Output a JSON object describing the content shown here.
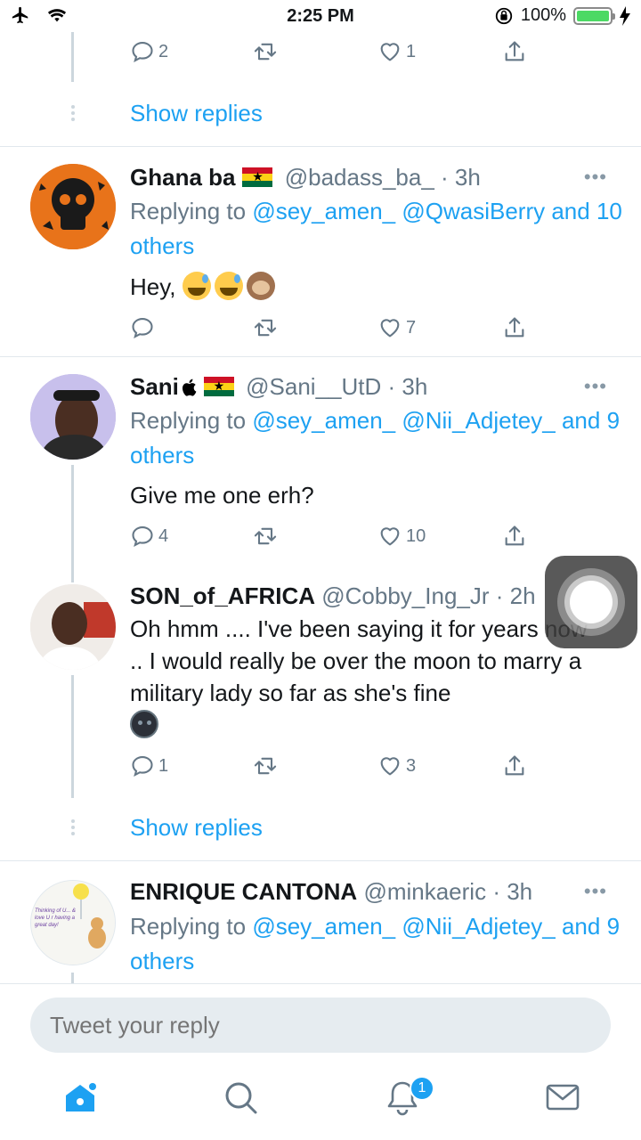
{
  "status_bar": {
    "time": "2:25 PM",
    "battery": "100%"
  },
  "top_actions": {
    "reply_count": "2",
    "retweet_count": "",
    "like_count": "1"
  },
  "show_replies_1": "Show replies",
  "show_replies_2": "Show replies",
  "tweets": [
    {
      "name": "Ghana ba",
      "handle": "@badass_ba_",
      "time": "3h",
      "replying_prefix": "Replying to",
      "replying_users": "@sey_amen_ @QwasiBerry",
      "replying_and": "and",
      "replying_others": "10 others",
      "text": "Hey,",
      "reply_count": "",
      "like_count": "7"
    },
    {
      "name": "Sani",
      "handle": "@Sani__UtD",
      "time": "3h",
      "replying_prefix": "Replying to",
      "replying_users": "@sey_amen_ @Nii_Adjetey_",
      "replying_and": "and",
      "replying_others": "9 others",
      "text": "Give me one erh?",
      "reply_count": "4",
      "like_count": "10"
    },
    {
      "name": "SON_of_AFRICA",
      "handle": "@Cobby_Ing_Jr",
      "time": "2h",
      "text": "Oh hmm .... I've been saying it for years now .. I would really be over the moon to marry a military lady so far as she's fine",
      "reply_count": "1",
      "like_count": "3"
    },
    {
      "name": "ENRIQUE CANTONA",
      "handle": "@minkaeric",
      "time": "3h",
      "replying_prefix": "Replying to",
      "replying_users": "@sey_amen_ @Nii_Adjetey_",
      "replying_and": "and",
      "replying_others": "9 others"
    }
  ],
  "avatar_card_text": "Thinking of U... & love U r having a great day!",
  "composer": {
    "placeholder": "Tweet your reply"
  },
  "tabbar": {
    "notification_badge": "1"
  },
  "icons": [
    "reply-icon",
    "retweet-icon",
    "like-icon",
    "share-icon",
    "more-icon",
    "home-icon",
    "search-icon",
    "bell-icon",
    "mail-icon"
  ],
  "colors": {
    "link": "#1da1f2",
    "muted": "#657786",
    "divider": "#e1e8ed"
  }
}
